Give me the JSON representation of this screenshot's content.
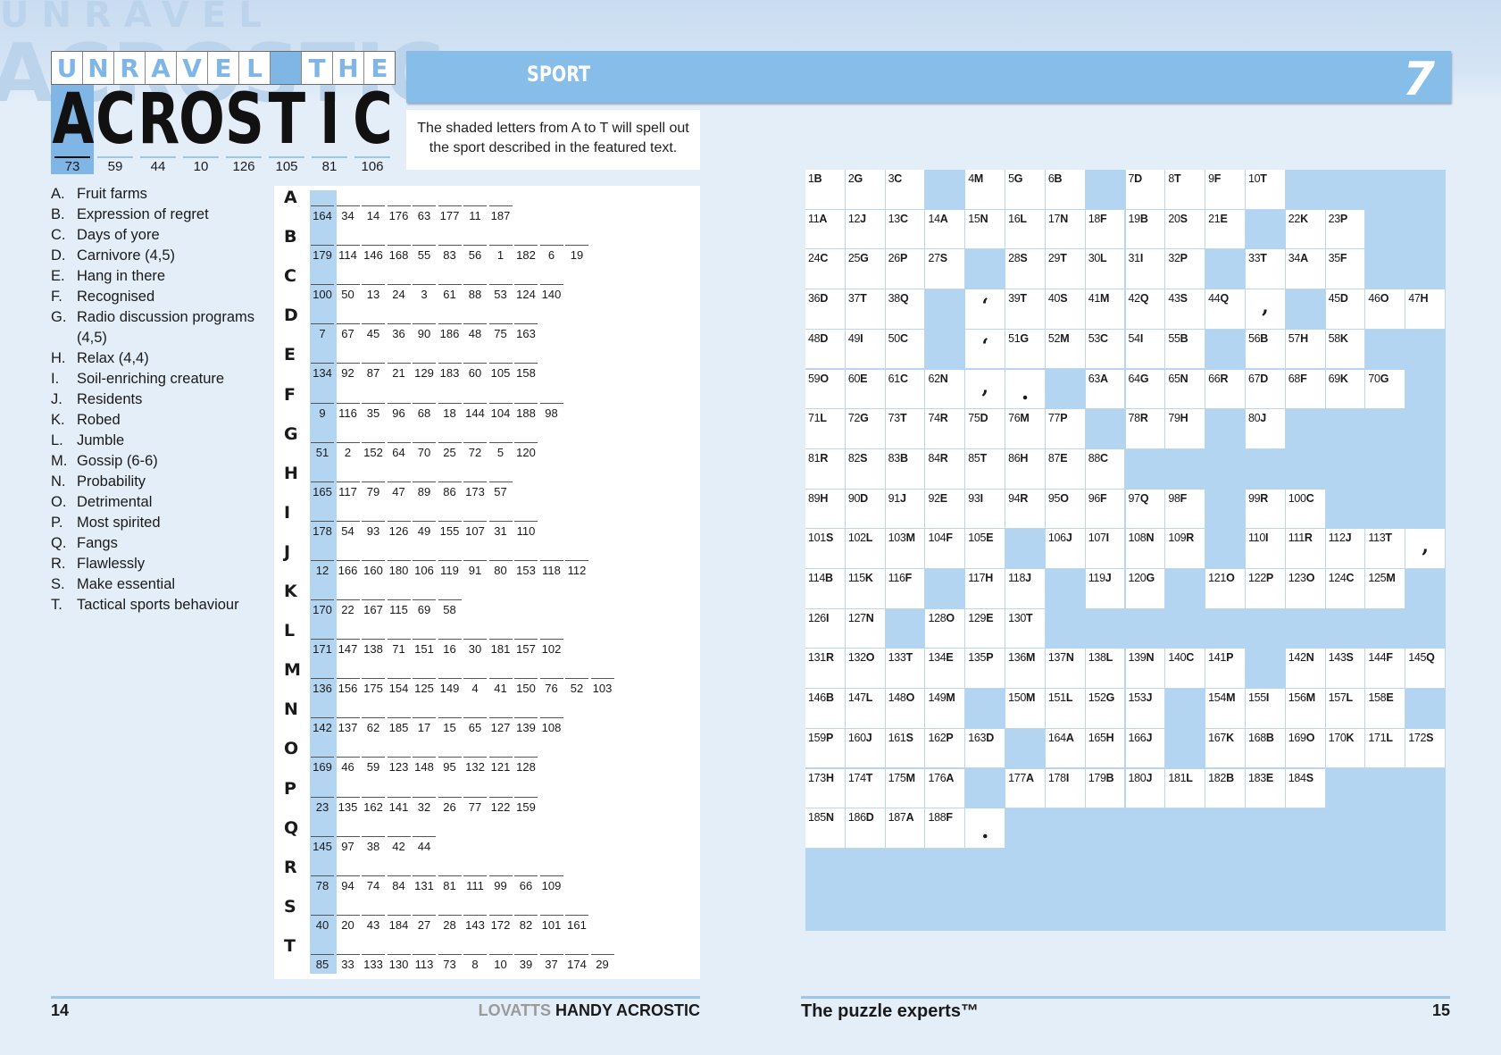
{
  "title": {
    "top_letters": [
      "U",
      "N",
      "R",
      "A",
      "V",
      "E",
      "L",
      "",
      "T",
      "H",
      "E"
    ],
    "main_letters": [
      "A",
      "C",
      "R",
      "O",
      "S",
      "T",
      "I",
      "C"
    ],
    "main_numbers": [
      "73",
      "59",
      "44",
      "10",
      "126",
      "105",
      "81",
      "106"
    ]
  },
  "banner": {
    "category": "SPORT",
    "puzzle_number": "7"
  },
  "instructions": "The shaded letters from A to T will spell out the sport described in the featured text.",
  "clues": [
    {
      "letter": "A.",
      "text": "Fruit farms"
    },
    {
      "letter": "B.",
      "text": "Expression of regret"
    },
    {
      "letter": "C.",
      "text": "Days of yore"
    },
    {
      "letter": "D.",
      "text": "Carnivore (4,5)"
    },
    {
      "letter": "E.",
      "text": "Hang in there"
    },
    {
      "letter": "F.",
      "text": "Recognised"
    },
    {
      "letter": "G.",
      "text": "Radio discussion programs (4,5)"
    },
    {
      "letter": "H.",
      "text": "Relax (4,4)"
    },
    {
      "letter": "I.",
      "text": "Soil-enriching creature"
    },
    {
      "letter": "J.",
      "text": "Residents"
    },
    {
      "letter": "K.",
      "text": "Robed"
    },
    {
      "letter": "L.",
      "text": "Jumble"
    },
    {
      "letter": "M.",
      "text": "Gossip (6-6)"
    },
    {
      "letter": "N.",
      "text": "Probability"
    },
    {
      "letter": "O.",
      "text": "Detrimental"
    },
    {
      "letter": "P.",
      "text": "Most spirited"
    },
    {
      "letter": "Q.",
      "text": "Fangs"
    },
    {
      "letter": "R.",
      "text": "Flawlessly"
    },
    {
      "letter": "S.",
      "text": "Make essential"
    },
    {
      "letter": "T.",
      "text": "Tactical sports behaviour"
    }
  ],
  "answers": [
    {
      "letter": "A",
      "numbers": [
        "164",
        "34",
        "14",
        "176",
        "63",
        "177",
        "11",
        "187"
      ]
    },
    {
      "letter": "B",
      "numbers": [
        "179",
        "114",
        "146",
        "168",
        "55",
        "83",
        "56",
        "1",
        "182",
        "6",
        "19"
      ]
    },
    {
      "letter": "C",
      "numbers": [
        "100",
        "50",
        "13",
        "24",
        "3",
        "61",
        "88",
        "53",
        "124",
        "140"
      ]
    },
    {
      "letter": "D",
      "numbers": [
        "7",
        "67",
        "45",
        "36",
        "90",
        "186",
        "48",
        "75",
        "163"
      ]
    },
    {
      "letter": "E",
      "numbers": [
        "134",
        "92",
        "87",
        "21",
        "129",
        "183",
        "60",
        "105",
        "158"
      ]
    },
    {
      "letter": "F",
      "numbers": [
        "9",
        "116",
        "35",
        "96",
        "68",
        "18",
        "144",
        "104",
        "188",
        "98"
      ]
    },
    {
      "letter": "G",
      "numbers": [
        "51",
        "2",
        "152",
        "64",
        "70",
        "25",
        "72",
        "5",
        "120"
      ]
    },
    {
      "letter": "H",
      "numbers": [
        "165",
        "117",
        "79",
        "47",
        "89",
        "86",
        "173",
        "57"
      ]
    },
    {
      "letter": "I",
      "numbers": [
        "178",
        "54",
        "93",
        "126",
        "49",
        "155",
        "107",
        "31",
        "110"
      ]
    },
    {
      "letter": "J",
      "numbers": [
        "12",
        "166",
        "160",
        "180",
        "106",
        "119",
        "91",
        "80",
        "153",
        "118",
        "112"
      ]
    },
    {
      "letter": "K",
      "numbers": [
        "170",
        "22",
        "167",
        "115",
        "69",
        "58"
      ]
    },
    {
      "letter": "L",
      "numbers": [
        "171",
        "147",
        "138",
        "71",
        "151",
        "16",
        "30",
        "181",
        "157",
        "102"
      ]
    },
    {
      "letter": "M",
      "numbers": [
        "136",
        "156",
        "175",
        "154",
        "125",
        "149",
        "4",
        "41",
        "150",
        "76",
        "52",
        "103"
      ]
    },
    {
      "letter": "N",
      "numbers": [
        "142",
        "137",
        "62",
        "185",
        "17",
        "15",
        "65",
        "127",
        "139",
        "108"
      ]
    },
    {
      "letter": "O",
      "numbers": [
        "169",
        "46",
        "59",
        "123",
        "148",
        "95",
        "132",
        "121",
        "128"
      ]
    },
    {
      "letter": "P",
      "numbers": [
        "23",
        "135",
        "162",
        "141",
        "32",
        "26",
        "77",
        "122",
        "159"
      ]
    },
    {
      "letter": "Q",
      "numbers": [
        "145",
        "97",
        "38",
        "42",
        "44"
      ]
    },
    {
      "letter": "R",
      "numbers": [
        "78",
        "94",
        "74",
        "84",
        "131",
        "81",
        "111",
        "99",
        "66",
        "109"
      ]
    },
    {
      "letter": "S",
      "numbers": [
        "40",
        "20",
        "43",
        "184",
        "27",
        "28",
        "143",
        "172",
        "82",
        "101",
        "161"
      ]
    },
    {
      "letter": "T",
      "numbers": [
        "85",
        "33",
        "133",
        "130",
        "113",
        "73",
        "8",
        "10",
        "39",
        "37",
        "174",
        "29"
      ]
    }
  ],
  "grid": [
    [
      "1B",
      "2G",
      "3C",
      "#",
      "4M",
      "5G",
      "6B",
      "#",
      "7D",
      "8T",
      "9F",
      "10T",
      "#",
      "#",
      "#",
      "#"
    ],
    [
      "11A",
      "12J",
      "13C",
      "14A",
      "15N",
      "16L",
      "17N",
      "18F",
      "19B",
      "20S",
      "21E",
      "#",
      "22K",
      "23P",
      "#",
      "#"
    ],
    [
      "24C",
      "25G",
      "26P",
      "27S",
      "#",
      "28S",
      "29T",
      "30L",
      "31I",
      "32P",
      "#",
      "33T",
      "34A",
      "35F",
      "#",
      "#"
    ],
    [
      "36D",
      "37T",
      "38Q",
      "#",
      "‘",
      "39T",
      "40S",
      "41M",
      "42Q",
      "43S",
      "44Q",
      ",",
      "#",
      "45D",
      "46O",
      "47H"
    ],
    [
      "48D",
      "49I",
      "50C",
      "#",
      "‘",
      "51G",
      "52M",
      "53C",
      "54I",
      "55B",
      "#",
      "56B",
      "57H",
      "58K",
      "#",
      "#"
    ],
    [
      "59O",
      "60E",
      "61C",
      "62N",
      ",",
      ".",
      "#",
      "63A",
      "64G",
      "65N",
      "66R",
      "67D",
      "68F",
      "69K",
      "70G",
      "#"
    ],
    [
      "71L",
      "72G",
      "73T",
      "74R",
      "75D",
      "76M",
      "77P",
      "#",
      "78R",
      "79H",
      "#",
      "80J",
      "#",
      "#",
      "#",
      "#"
    ],
    [
      "81R",
      "82S",
      "83B",
      "84R",
      "85T",
      "86H",
      "87E",
      "88C",
      "#",
      "#",
      "#",
      "#",
      "#",
      "#",
      "#",
      "#"
    ],
    [
      "89H",
      "90D",
      "91J",
      "92E",
      "93I",
      "94R",
      "95O",
      "96F",
      "97Q",
      "98F",
      "#",
      "99R",
      "100C",
      "#",
      "#",
      "#"
    ],
    [
      "101S",
      "102L",
      "103M",
      "104F",
      "105E",
      "#",
      "106J",
      "107I",
      "108N",
      "109R",
      "#",
      "110I",
      "111R",
      "112J",
      "113T",
      ","
    ],
    [
      "114B",
      "115K",
      "116F",
      "#",
      "117H",
      "118J",
      "#",
      "119J",
      "120G",
      "#",
      "121O",
      "122P",
      "123O",
      "124C",
      "125M",
      "#"
    ],
    [
      "126I",
      "127N",
      "#",
      "128O",
      "129E",
      "130T",
      "#",
      "#",
      "#",
      "#",
      "#",
      "#",
      "#",
      "#",
      "#",
      "#"
    ],
    [
      "131R",
      "132O",
      "133T",
      "134E",
      "135P",
      "136M",
      "137N",
      "138L",
      "139N",
      "140C",
      "141P",
      "#",
      "142N",
      "143S",
      "144F",
      "145Q"
    ],
    [
      "146B",
      "147L",
      "148O",
      "149M",
      "#",
      "150M",
      "151L",
      "152G",
      "153J",
      "#",
      "154M",
      "155I",
      "156M",
      "157L",
      "158E",
      "#"
    ],
    [
      "159P",
      "160J",
      "161S",
      "162P",
      "163D",
      "#",
      "164A",
      "165H",
      "166J",
      "#",
      "167K",
      "168B",
      "169O",
      "170K",
      "171L",
      "172S"
    ],
    [
      "173H",
      "174T",
      "175M",
      "176A",
      "#",
      "177A",
      "178I",
      "179B",
      "180J",
      "181L",
      "182B",
      "183E",
      "184S",
      "#",
      "#",
      "#"
    ],
    [
      "185N",
      "186D",
      "187A",
      "188F",
      ".",
      "#",
      "#",
      "#",
      "#",
      "#",
      "#",
      "#",
      "#",
      "#",
      "#",
      "#"
    ]
  ],
  "footer": {
    "left_page": "14",
    "brand_grey": "LOVATTS",
    "brand_black": "HANDY ACROSTIC",
    "tagline": "The puzzle experts™",
    "right_page": "15"
  },
  "colors": {
    "accent": "#86bde9",
    "shade": "#b4d5f1",
    "background": "#e4eef9"
  }
}
